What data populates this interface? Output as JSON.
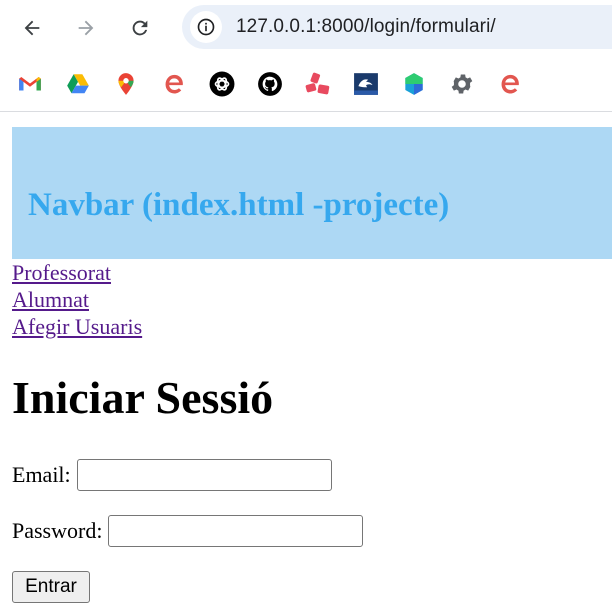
{
  "browser": {
    "url": "127.0.0.1:8000/login/formulari/",
    "nav_icons": [
      "back-arrow-icon",
      "forward-arrow-icon",
      "reload-icon",
      "site-info-icon"
    ],
    "bookmarks": [
      {
        "icon": "gmail-icon"
      },
      {
        "icon": "google-drive-icon"
      },
      {
        "icon": "google-maps-icon"
      },
      {
        "icon": "e-logo-icon"
      },
      {
        "icon": "openai-icon"
      },
      {
        "icon": "github-icon"
      },
      {
        "icon": "red-shapes-icon"
      },
      {
        "icon": "blue-square-logo-icon"
      },
      {
        "icon": "green-blue-hexagon-icon"
      },
      {
        "icon": "gear-icon"
      },
      {
        "icon": "e-logo-icon"
      }
    ]
  },
  "navbar": {
    "title": "Navbar (index.html -projecte)"
  },
  "links": {
    "items": [
      "Professorat",
      "Alumnat",
      "Afegir Usuaris"
    ]
  },
  "login": {
    "title": "Iniciar Sessió",
    "email_label": "Email:",
    "email_value": "",
    "password_label": "Password:",
    "password_value": "",
    "submit_label": "Entrar"
  }
}
